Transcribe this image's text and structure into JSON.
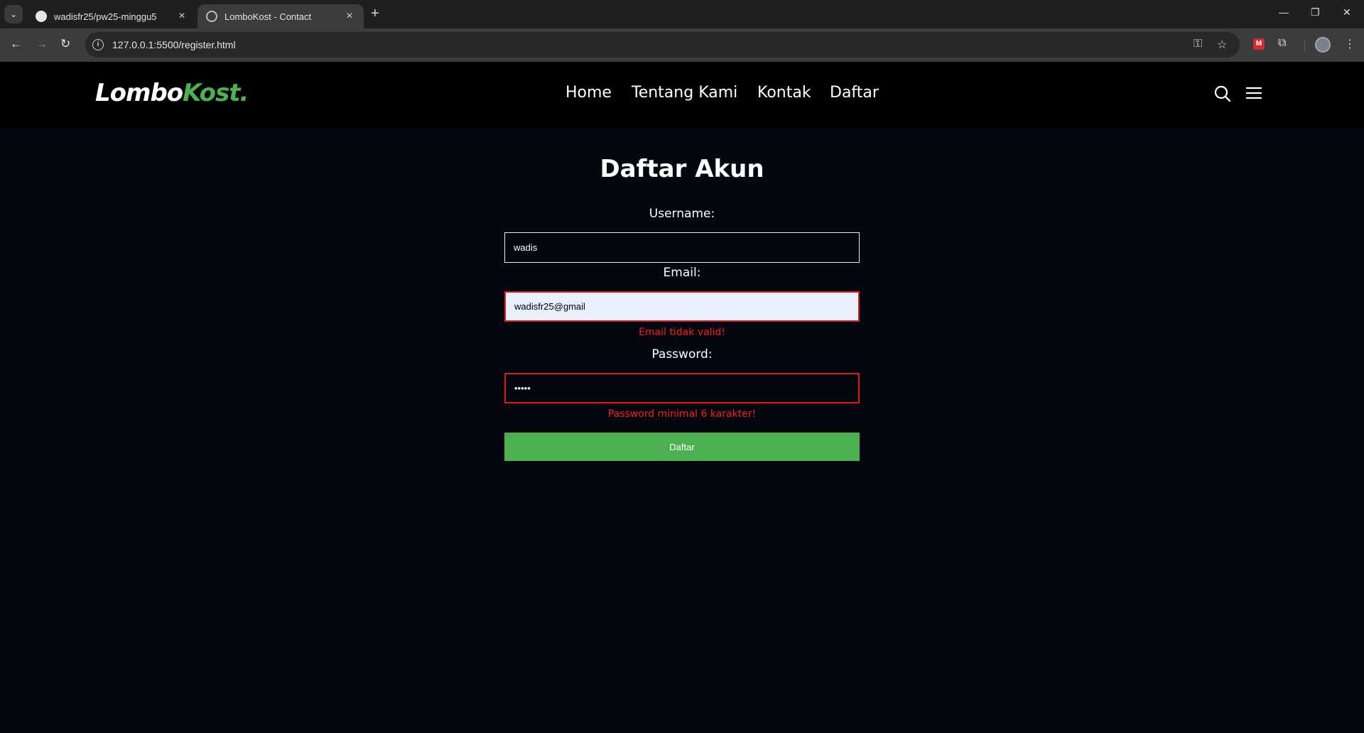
{
  "browser": {
    "tabs": [
      {
        "title": "wadisfr25/pw25-minggu5",
        "icon": "github-icon",
        "active": false
      },
      {
        "title": "LomboKost - Contact",
        "icon": "globe-icon",
        "active": true
      }
    ],
    "url": "127.0.0.1:5500/register.html"
  },
  "site": {
    "logo_main": "Lombo",
    "logo_accent": "Kost.",
    "nav": [
      "Home",
      "Tentang Kami",
      "Kontak",
      "Daftar"
    ],
    "accent_color": "#4caf50"
  },
  "form": {
    "title": "Daftar Akun",
    "username_label": "Username:",
    "username_value": "wadis",
    "email_label": "Email:",
    "email_value": "wadisfr25@gmail",
    "email_error": "Email tidak valid!",
    "password_label": "Password:",
    "password_value": "•••••",
    "password_error": "Password minimal 6 karakter!",
    "submit_label": "Daftar",
    "error_color": "#ff1a1a"
  }
}
